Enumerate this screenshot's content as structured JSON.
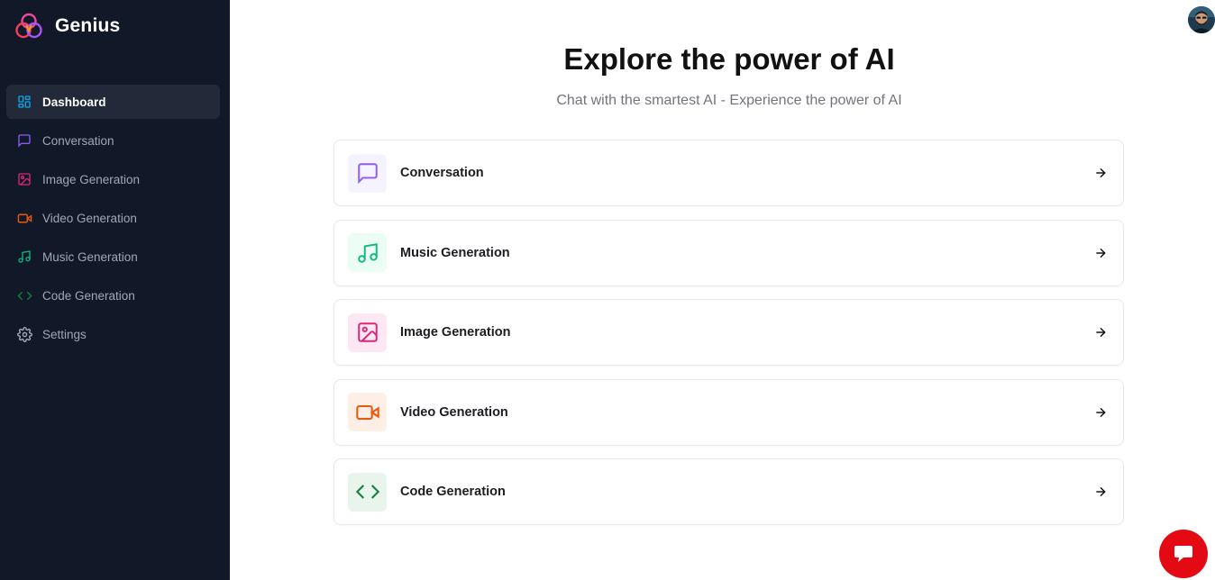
{
  "app": {
    "name": "Genius"
  },
  "sidebar": {
    "items": [
      {
        "label": "Dashboard",
        "icon": "layout-dashboard-icon",
        "color": "#0ea5e9",
        "active": true
      },
      {
        "label": "Conversation",
        "icon": "message-square-icon",
        "color": "#8b5cf6"
      },
      {
        "label": "Image Generation",
        "icon": "image-icon",
        "color": "#db2777"
      },
      {
        "label": "Video Generation",
        "icon": "video-icon",
        "color": "#ea580c"
      },
      {
        "label": "Music Generation",
        "icon": "music-icon",
        "color": "#10b981"
      },
      {
        "label": "Code Generation",
        "icon": "code-icon",
        "color": "#15803d"
      },
      {
        "label": "Settings",
        "icon": "settings-icon",
        "color": "#a1a7b3"
      }
    ]
  },
  "main": {
    "title": "Explore the power of AI",
    "subtitle": "Chat with the smartest AI - Experience the power of AI",
    "tools": [
      {
        "label": "Conversation",
        "icon": "message-square-icon",
        "color": "#8b5cf6",
        "bg": "#f5f3ff"
      },
      {
        "label": "Music Generation",
        "icon": "music-icon",
        "color": "#10b981",
        "bg": "#ecfdf5"
      },
      {
        "label": "Image Generation",
        "icon": "image-icon",
        "color": "#db2777",
        "bg": "#fce7f3"
      },
      {
        "label": "Video Generation",
        "icon": "video-icon",
        "color": "#ea580c",
        "bg": "#fdeee6"
      },
      {
        "label": "Code Generation",
        "icon": "code-icon",
        "color": "#15803d",
        "bg": "#e9f4ec"
      }
    ]
  },
  "header": {
    "avatar_icon": "user-avatar"
  },
  "support": {
    "icon": "chat-bubble-icon",
    "color": "#e30a14"
  }
}
